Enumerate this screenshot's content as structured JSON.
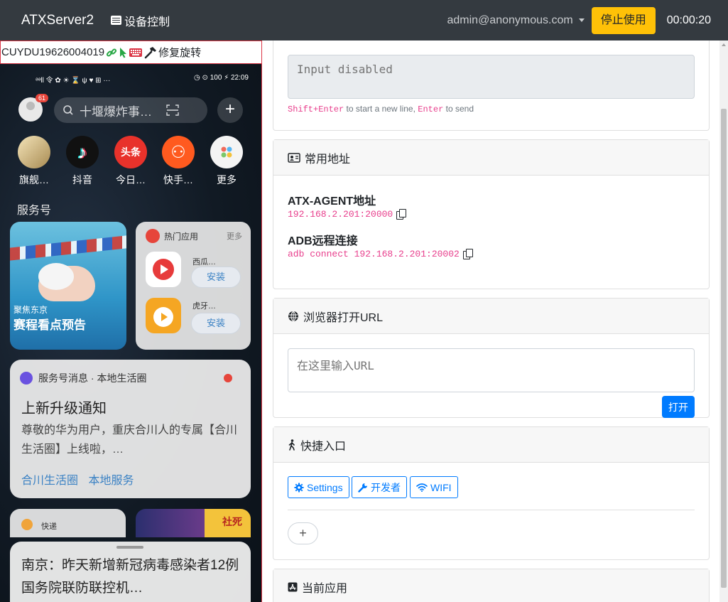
{
  "navbar": {
    "brand": "ATXServer2",
    "device_control": "设备控制",
    "user": "admin@anonymous.com",
    "stop_button": "停止使用",
    "timer": "00:00:20"
  },
  "device_bar": {
    "serial": "CUYDU19626004019",
    "fix_rotation": "修复旋转"
  },
  "phone": {
    "status_time": "22:09",
    "status_left": "ᵊᵊll 令 ✿ ☀ ⌛ ψ ♥ ⊞ ···",
    "status_right": "◷ ⊙ 100 ⚡",
    "avatar_badge": "61",
    "search_text": "十堰爆炸事…",
    "apps": [
      {
        "label": "旗舰…",
        "color": "#d6c39a",
        "text": ""
      },
      {
        "label": "抖音",
        "color": "#111111",
        "text": "♪"
      },
      {
        "label": "今日…",
        "color": "#e8322b",
        "text": "头条"
      },
      {
        "label": "快手…",
        "color": "#ff5a1f",
        "text": "⚇"
      },
      {
        "label": "更多",
        "color": "#f4f4f4",
        "text": ""
      }
    ],
    "section_title": "服务号",
    "swim_card": {
      "sub": "聚焦东京",
      "title": "赛程看点预告"
    },
    "hot_card": {
      "title": "热门应用",
      "more": "更多",
      "items": [
        {
          "name": "西瓜…",
          "button": "安装",
          "color": "#e73b3b"
        },
        {
          "name": "虎牙…",
          "button": "安装",
          "color": "#f5a623"
        }
      ]
    },
    "msg_card": {
      "header": "服务号消息 · 本地生活圈",
      "title": "上新升级通知",
      "body": "尊敬的华为用户，重庆合川人的专属【合川生活圈】上线啦，…",
      "links": "合川生活圈  本地服务"
    },
    "small_card": "快递",
    "show_card": "社死",
    "news": "南京：昨天新增新冠病毒感染者12例 国务院联防联控机…"
  },
  "input_card": {
    "placeholder": "Input disabled",
    "hint_key1": "Shift+Enter",
    "hint_text1": " to start a new line, ",
    "hint_key2": "Enter",
    "hint_text2": " to send"
  },
  "address_card": {
    "header": "常用地址",
    "atx_title": "ATX-AGENT地址",
    "atx_value": "192.168.2.201:20000",
    "adb_title": "ADB远程连接",
    "adb_value": "adb connect 192.168.2.201:20002"
  },
  "browser_card": {
    "header": "浏览器打开URL",
    "placeholder": "在这里输入URL",
    "open_button": "打开"
  },
  "shortcut_card": {
    "header": "快捷入口",
    "buttons": [
      "Settings",
      "开发者",
      "WIFI"
    ],
    "add": "+"
  },
  "current_app_card": {
    "header": "当前应用"
  },
  "colors": {
    "navbar": "#343a40",
    "warning": "#ffc107",
    "primary": "#007bff",
    "code": "#e83e8c",
    "danger": "#dc3545"
  }
}
